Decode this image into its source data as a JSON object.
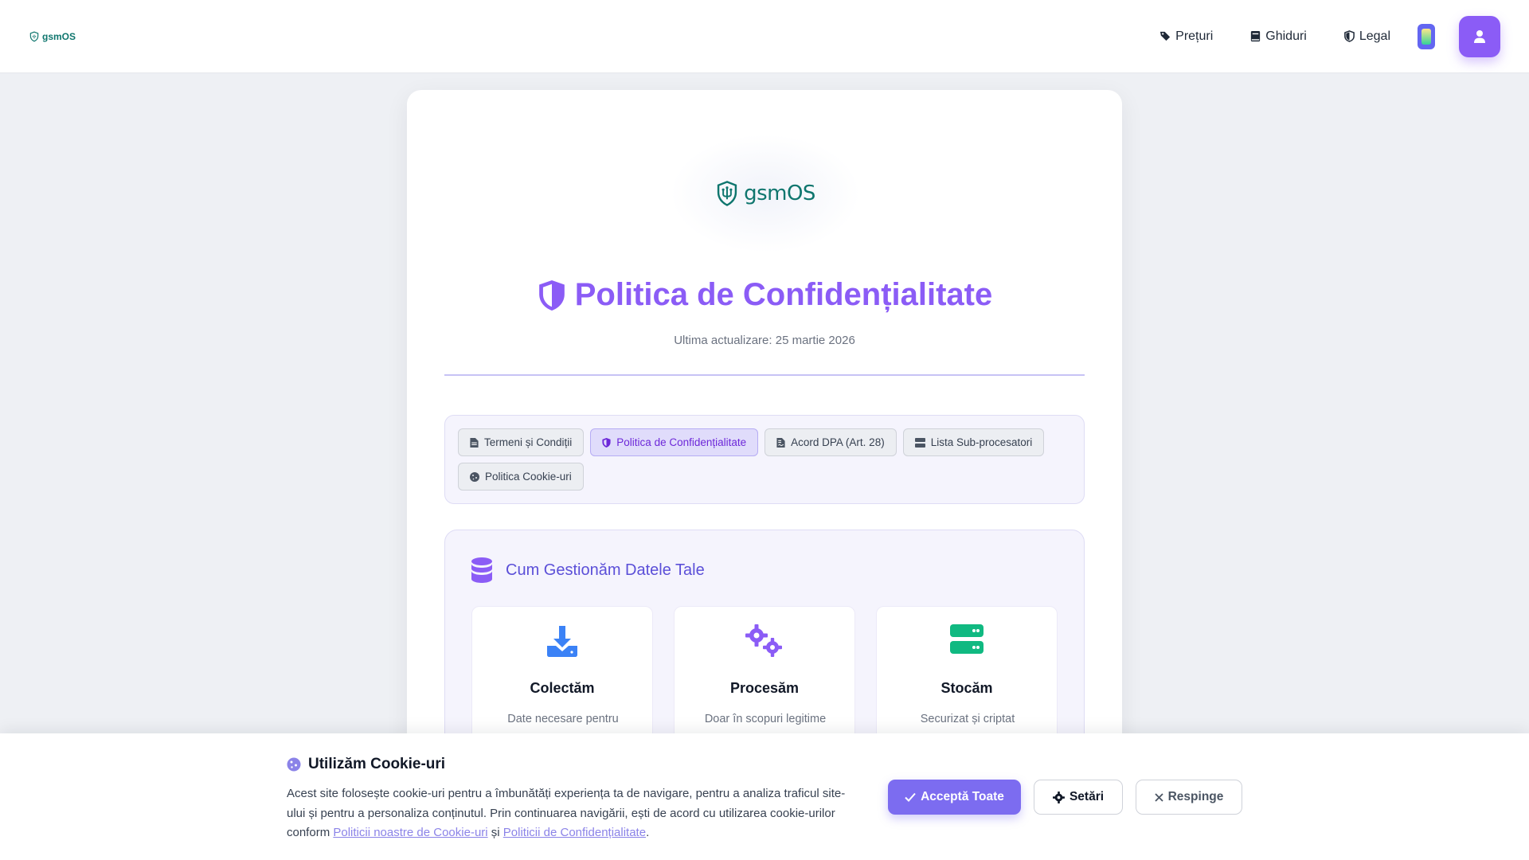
{
  "header": {
    "brand": "gsmOS",
    "nav": [
      {
        "label": "Prețuri",
        "icon": "tags-icon"
      },
      {
        "label": "Ghiduri",
        "icon": "book-icon"
      },
      {
        "label": "Legal",
        "icon": "shield-icon"
      }
    ]
  },
  "card": {
    "logo_text": "gsmOS",
    "title": "Politica de Confidențialitate",
    "updated": "Ultima actualizare: 25 martie 2026",
    "tabs": [
      {
        "label": "Termeni și Condiții",
        "icon": "file-icon",
        "active": false
      },
      {
        "label": "Politica de Confidențialitate",
        "icon": "shield-icon",
        "active": true
      },
      {
        "label": "Acord DPA (Art. 28)",
        "icon": "file-contract-icon",
        "active": false
      },
      {
        "label": "Lista Sub-procesatori",
        "icon": "server-icon",
        "active": false
      },
      {
        "label": "Politica Cookie-uri",
        "icon": "cookie-icon",
        "active": false
      }
    ],
    "data_section": {
      "title": "Cum Gestionăm Datele Tale",
      "features": [
        {
          "title": "Colectăm",
          "text": "Date necesare pentru servicii",
          "icon": "download-icon",
          "color": "#3b82f6"
        },
        {
          "title": "Procesăm",
          "text": "Doar în scopuri legitime",
          "icon": "gears-icon",
          "color": "#8b5cf6"
        },
        {
          "title": "Stocăm",
          "text": "Securizat și criptat",
          "icon": "server-icon",
          "color": "#10b981"
        }
      ]
    }
  },
  "cookie_banner": {
    "title": "Utilizăm Cookie-uri",
    "text_before": "Acest site folosește cookie-uri pentru a îmbunătăți experiența ta de navigare, pentru a analiza traficul site-ului și pentru a personaliza conținutul. Prin continuarea navigării, ești de acord cu utilizarea cookie-urilor conform ",
    "link1": "Politicii noastre de Cookie-uri",
    "and_text": " și ",
    "link2": "Politicii de Confidențialitate",
    "end_text": ".",
    "accept_label": "Acceptă Toate",
    "settings_label": "Setări",
    "reject_label": "Respinge"
  },
  "colors": {
    "accent": "#8b5cf6",
    "brand_teal": "#0f766e"
  }
}
